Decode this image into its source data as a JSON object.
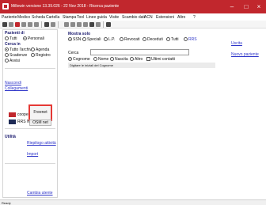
{
  "window": {
    "title": "Millewin versione 13.39.026 - 22 Nov 2018 - Ricerca paziente"
  },
  "menu": [
    "Paziente",
    "Medico",
    "Scheda",
    "Cartella",
    "Stampa",
    "Tool",
    "Linee guida",
    "Visite",
    "Scambio dati",
    "ACN",
    "Estensioni",
    "Altro",
    "?"
  ],
  "sidebar": {
    "pazienti_title": "Pazienti di",
    "pazienti_opts": [
      "Tutti",
      "Personali"
    ],
    "cerca_title": "Cerca in",
    "cerca_opts": [
      "Tutto l'archivio",
      "Agenda",
      "Scadenze",
      "Registro",
      "Avvisi"
    ],
    "nascondi": "Nascondi",
    "collegamenti": "Collegamenti",
    "cooperativa": "cooperativa",
    "freenet": "Freenet",
    "rrsnet": "RRS NET",
    "osm": "OSM net",
    "utilita": "Utilità",
    "riepilogo": "Riepilogo attività",
    "import": "Import",
    "cambia_utente": "Cambia utente"
  },
  "mostra": {
    "title": "Mostra solo",
    "options": [
      "SSN",
      "Speciali",
      "L.P.",
      "Revocati",
      "Deceduti",
      "Tutti",
      "RRS"
    ]
  },
  "search": {
    "label": "Cerca",
    "value": "",
    "by_options": [
      "Cognome",
      "Nome",
      "Nascita",
      "Altro"
    ],
    "ultimi": "Ultimi contatti",
    "hint": "Digitare le iniziali del Cognome"
  },
  "right_links": {
    "uscita": "Uscita",
    "nuovo": "Nuovo paziente"
  },
  "status": "Ready"
}
